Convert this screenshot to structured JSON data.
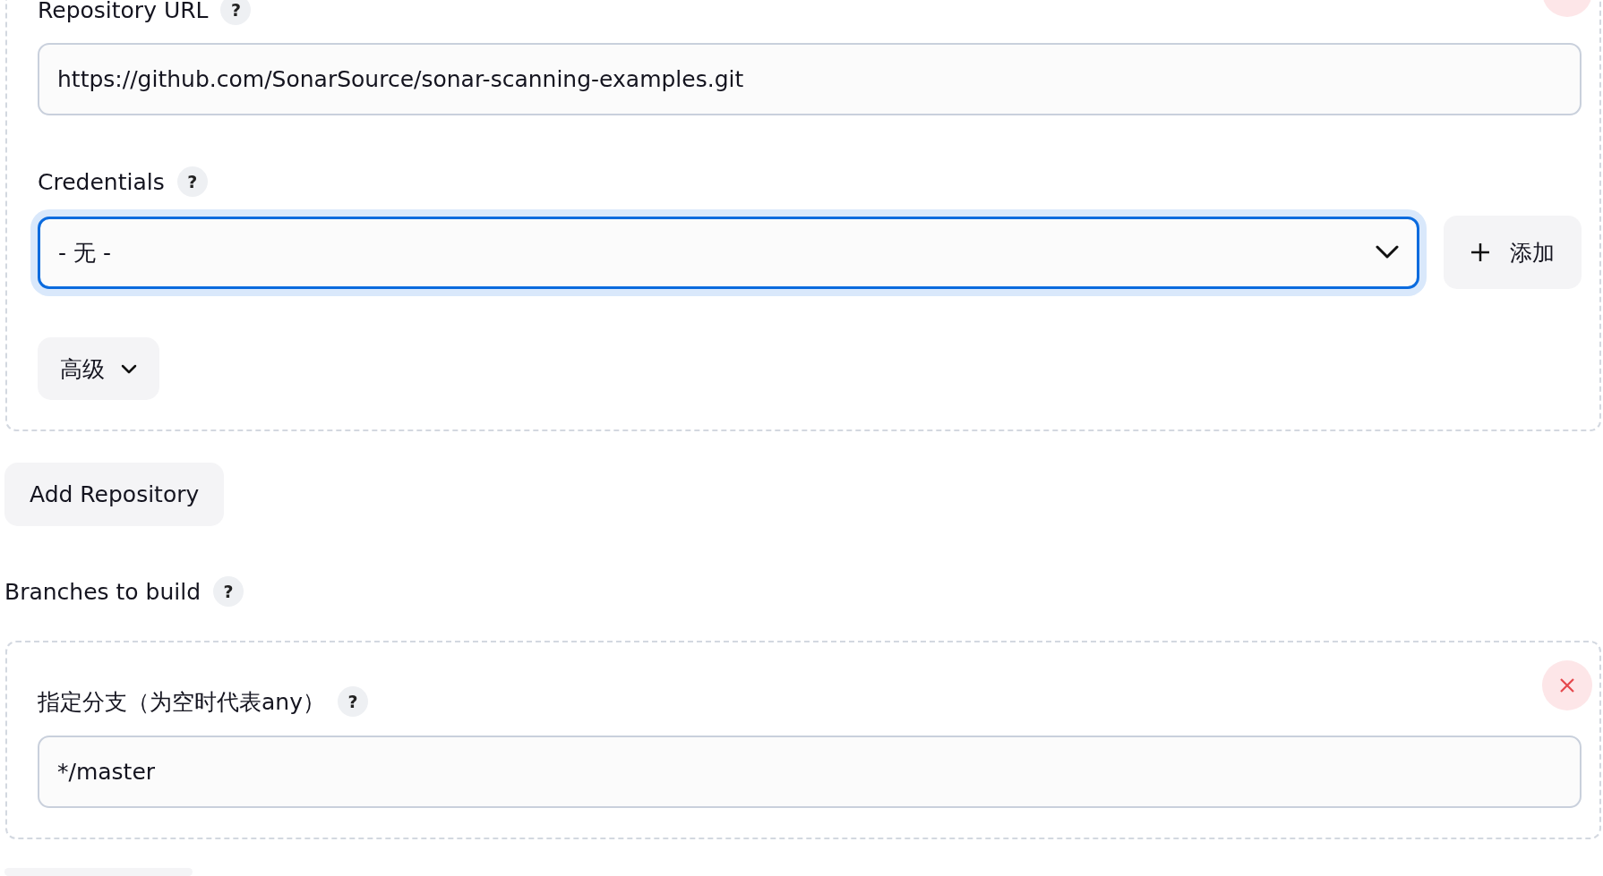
{
  "repository": {
    "url_label": "Repository URL",
    "url_help": "?",
    "url": "https://github.com/SonarSource/sonar-scanning-examples.git",
    "credentials_label": "Credentials",
    "credentials_help": "?",
    "credentials": {
      "value": "- 无 -",
      "focused": true
    },
    "add_credentials_button": "添加",
    "advanced_button": "高级"
  },
  "add_repository_button": "Add Repository",
  "branches": {
    "label": "Branches to build",
    "help": "?",
    "items": [
      {
        "label": "指定分支（为空时代表any）",
        "help": "?",
        "value": "*/master"
      }
    ]
  }
}
